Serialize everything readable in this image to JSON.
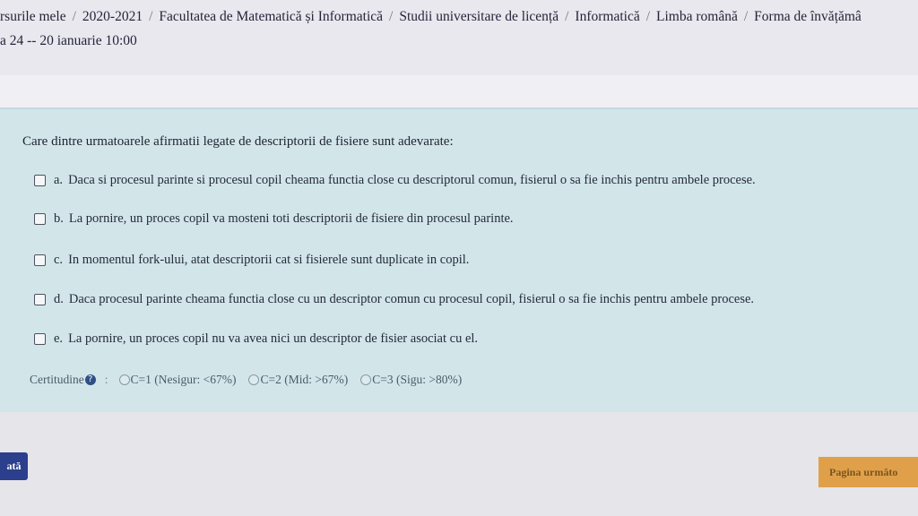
{
  "breadcrumb": [
    "rsurile mele",
    "2020-2021",
    "Facultatea de Matematică și Informatică",
    "Studii universitare de licență",
    "Informatică",
    "Limba română",
    "Forma de învățămâ"
  ],
  "subtitle": "a 24 -- 20 ianuarie 10:00",
  "question": {
    "text": "Care dintre urmatoarele afirmatii legate de descriptorii de fisiere sunt adevarate:",
    "answers": [
      {
        "letter": "a.",
        "text": "Daca si procesul parinte si procesul copil cheama functia close cu descriptorul comun, fisierul o sa fie inchis pentru ambele procese."
      },
      {
        "letter": "b.",
        "text": "La pornire, un proces copil va mosteni toti descriptorii de fisiere din procesul parinte."
      },
      {
        "letter": "c.",
        "text": "In momentul fork-ului, atat descriptorii cat si fisierele sunt duplicate in copil."
      },
      {
        "letter": "d.",
        "text": "Daca procesul parinte cheama functia close cu un descriptor comun cu procesul copil, fisierul o sa fie inchis pentru ambele procese."
      },
      {
        "letter": "e.",
        "text": "La pornire, un proces copil nu va avea nici un descriptor de fisier asociat cu el."
      }
    ]
  },
  "certitude": {
    "label": "Certitudine",
    "colon": ":",
    "options": [
      "C=1 (Nesigur: <67%)",
      "C=2 (Mid: >67%)",
      "C=3 (Sigu: >80%)"
    ]
  },
  "nav": {
    "prev_label": "ată",
    "next_label": "Pagina următo"
  },
  "colors": {
    "question_bg": "#d2e6ea",
    "prev_button": "#2b3f8c",
    "next_button": "#e0a04a"
  },
  "icons": {
    "help": "question-circle-icon",
    "checkbox": "checkbox-icon",
    "radio": "radio-icon"
  }
}
